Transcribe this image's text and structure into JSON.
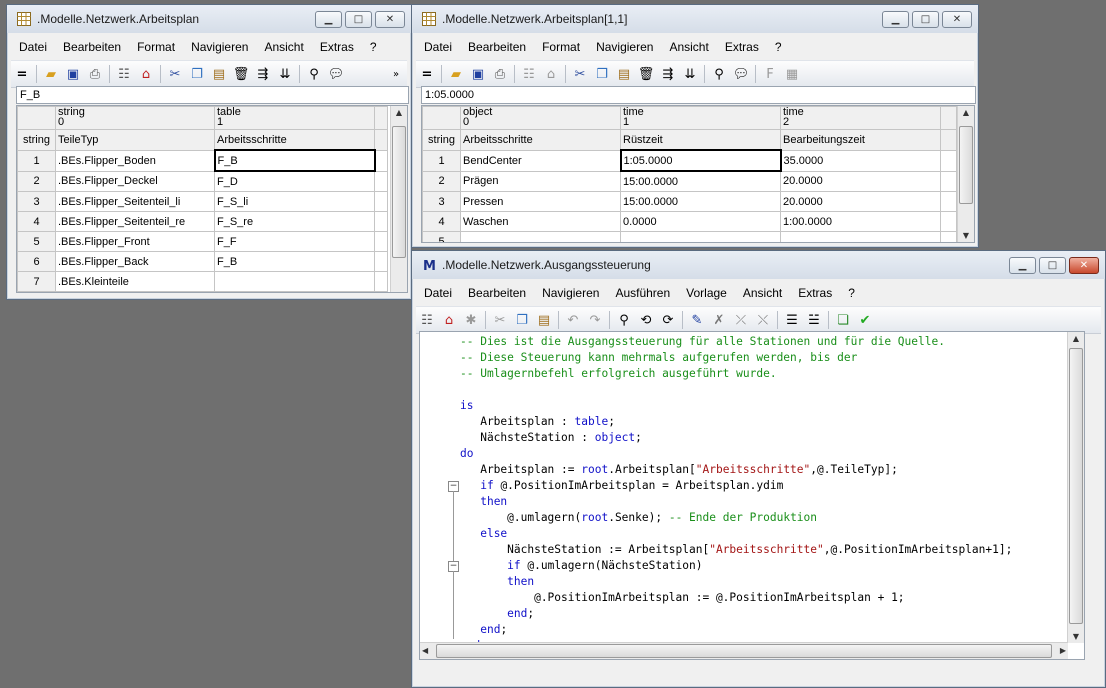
{
  "win1": {
    "title": ".Modelle.Netzwerk.Arbeitsplan",
    "menu": [
      "Datei",
      "Bearbeiten",
      "Format",
      "Navigieren",
      "Ansicht",
      "Extras",
      "?"
    ],
    "field_value": "F_B",
    "col_headers": [
      {
        "type": "string",
        "index": "0",
        "name": "TeileTyp"
      },
      {
        "type": "table",
        "index": "1",
        "name": "Arbeitsschritte"
      }
    ],
    "corner_label": "string",
    "rows": [
      {
        "n": "1",
        "c1": ".BEs.Flipper_Boden",
        "c2": "F_B"
      },
      {
        "n": "2",
        "c1": ".BEs.Flipper_Deckel",
        "c2": "F_D"
      },
      {
        "n": "3",
        "c1": ".BEs.Flipper_Seitenteil_li",
        "c2": "F_S_li"
      },
      {
        "n": "4",
        "c1": ".BEs.Flipper_Seitenteil_re",
        "c2": "F_S_re"
      },
      {
        "n": "5",
        "c1": ".BEs.Flipper_Front",
        "c2": "F_F"
      },
      {
        "n": "6",
        "c1": ".BEs.Flipper_Back",
        "c2": "F_B"
      },
      {
        "n": "7",
        "c1": ".BEs.Kleinteile",
        "c2": ""
      }
    ]
  },
  "win2": {
    "title": ".Modelle.Netzwerk.Arbeitsplan[1,1]",
    "menu": [
      "Datei",
      "Bearbeiten",
      "Format",
      "Navigieren",
      "Ansicht",
      "Extras",
      "?"
    ],
    "field_value": "1:05.0000",
    "col_headers": [
      {
        "type": "object",
        "index": "0",
        "name": "Arbeitsschritte"
      },
      {
        "type": "time",
        "index": "1",
        "name": "Rüstzeit"
      },
      {
        "type": "time",
        "index": "2",
        "name": "Bearbeitungszeit"
      }
    ],
    "corner_label": "string",
    "rows": [
      {
        "n": "1",
        "c1": "BendCenter",
        "c2": "1:05.0000",
        "c3": "35.0000"
      },
      {
        "n": "2",
        "c1": "Prägen",
        "c2": "15:00.0000",
        "c3": "20.0000"
      },
      {
        "n": "3",
        "c1": "Pressen",
        "c2": "15:00.0000",
        "c3": "20.0000"
      },
      {
        "n": "4",
        "c1": "Waschen",
        "c2": "0.0000",
        "c3": "1:00.0000"
      },
      {
        "n": "5",
        "c1": "",
        "c2": "",
        "c3": ""
      }
    ]
  },
  "win3": {
    "title": ".Modelle.Netzwerk.Ausgangssteuerung",
    "menu": [
      "Datei",
      "Bearbeiten",
      "Navigieren",
      "Ausführen",
      "Vorlage",
      "Ansicht",
      "Extras",
      "?"
    ],
    "code": [
      [
        [
          "cm",
          "-- Dies ist die Ausgangssteuerung für alle Stationen und für die Quelle."
        ]
      ],
      [
        [
          "cm",
          "-- Diese Steuerung kann mehrmals aufgerufen werden, bis der"
        ]
      ],
      [
        [
          "cm",
          "-- Umlagernbefehl erfolgreich ausgeführt wurde."
        ]
      ],
      [],
      [
        [
          "kw",
          "is"
        ]
      ],
      [
        [
          "plain",
          "   Arbeitsplan : "
        ],
        [
          "kw",
          "table"
        ],
        [
          "plain",
          ";"
        ]
      ],
      [
        [
          "plain",
          "   NächsteStation : "
        ],
        [
          "kw",
          "object"
        ],
        [
          "plain",
          ";"
        ]
      ],
      [
        [
          "kw",
          "do"
        ]
      ],
      [
        [
          "plain",
          "   Arbeitsplan := "
        ],
        [
          "kw",
          "root"
        ],
        [
          "plain",
          ".Arbeitsplan["
        ],
        [
          "st",
          "\"Arbeitsschritte\""
        ],
        [
          "plain",
          ",@.TeileTyp];"
        ]
      ],
      [
        [
          "plain",
          "   "
        ],
        [
          "kw",
          "if"
        ],
        [
          "plain",
          " @.PositionImArbeitsplan = Arbeitsplan.ydim"
        ]
      ],
      [
        [
          "plain",
          "   "
        ],
        [
          "kw",
          "then"
        ]
      ],
      [
        [
          "plain",
          "       @.umlagern("
        ],
        [
          "kw",
          "root"
        ],
        [
          "plain",
          ".Senke); "
        ],
        [
          "cm",
          "-- Ende der Produktion"
        ]
      ],
      [
        [
          "plain",
          "   "
        ],
        [
          "kw",
          "else"
        ]
      ],
      [
        [
          "plain",
          "       NächsteStation := Arbeitsplan["
        ],
        [
          "st",
          "\"Arbeitsschritte\""
        ],
        [
          "plain",
          ",@.PositionImArbeitsplan+1];"
        ]
      ],
      [
        [
          "plain",
          "       "
        ],
        [
          "kw",
          "if"
        ],
        [
          "plain",
          " @.umlagern(NächsteStation)"
        ]
      ],
      [
        [
          "plain",
          "       "
        ],
        [
          "kw",
          "then"
        ]
      ],
      [
        [
          "plain",
          "           @.PositionImArbeitsplan := @.PositionImArbeitsplan + 1;"
        ]
      ],
      [
        [
          "plain",
          "       "
        ],
        [
          "kw",
          "end"
        ],
        [
          "plain",
          ";"
        ]
      ],
      [
        [
          "plain",
          "   "
        ],
        [
          "kw",
          "end"
        ],
        [
          "plain",
          ";"
        ]
      ],
      [
        [
          "kw",
          "end"
        ],
        [
          "plain",
          ";"
        ]
      ]
    ]
  }
}
